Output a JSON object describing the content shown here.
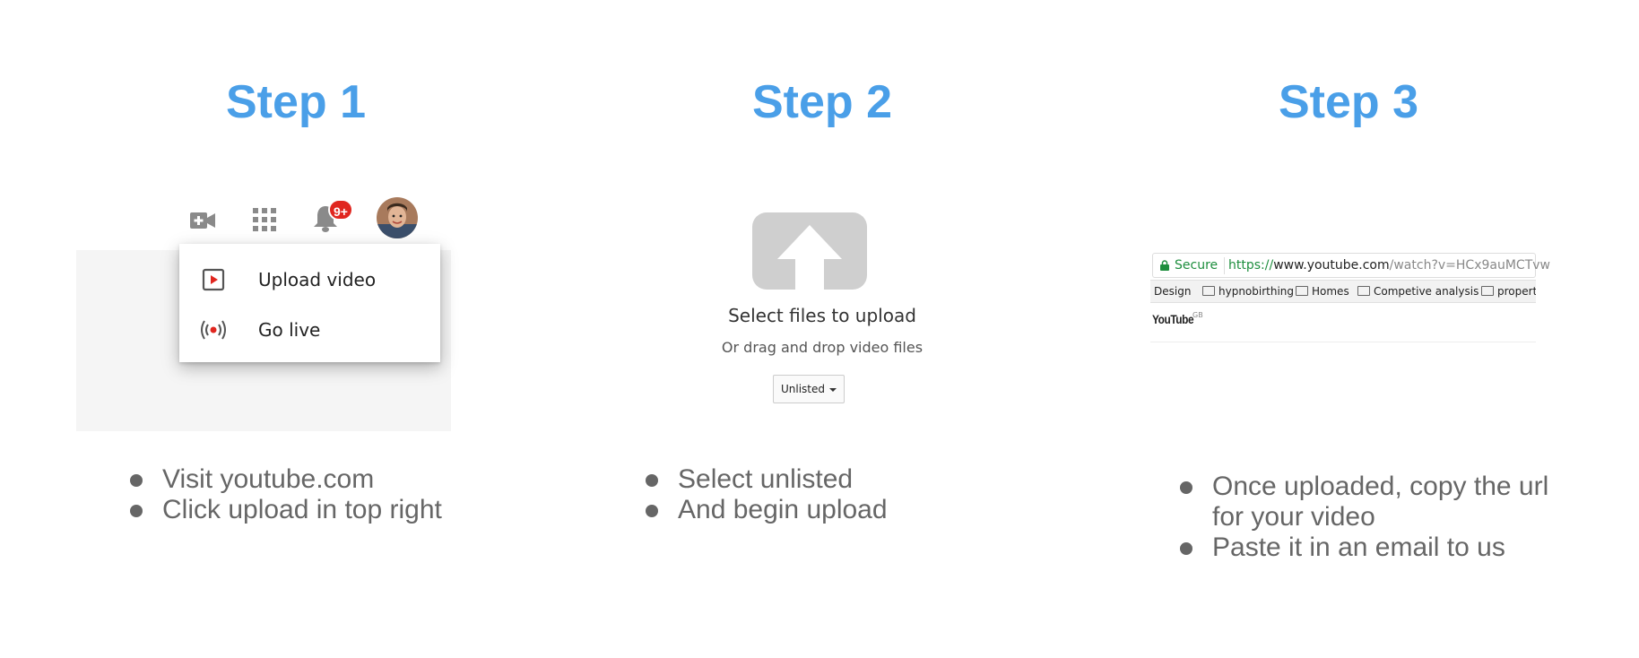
{
  "steps": [
    {
      "title": "Step 1",
      "bullets": [
        "Visit youtube.com",
        "Click upload in top right"
      ],
      "toolbar": {
        "icons": [
          "video-camera-add-icon",
          "apps-grid-icon",
          "notifications-bell-icon",
          "avatar"
        ],
        "notification_badge": "9+"
      },
      "menu": {
        "items": [
          {
            "label": "Upload video",
            "icon": "upload-video-icon"
          },
          {
            "label": "Go live",
            "icon": "go-live-icon"
          }
        ]
      }
    },
    {
      "title": "Step 2",
      "bullets": [
        "Select unlisted",
        "And begin upload"
      ],
      "upload": {
        "title": "Select files to upload",
        "subtitle": "Or drag and drop video files",
        "privacy_select": "Unlisted"
      }
    },
    {
      "title": "Step 3",
      "bullets": [
        "Once uploaded, copy the url for your video",
        "Paste it in an email to us"
      ],
      "browser": {
        "secure_label": "Secure",
        "url_scheme": "https://",
        "url_host": "www.youtube.com",
        "url_path": "/watch?v=HCx9auMCTvw",
        "bookmarks": [
          "Design",
          "hypnobirthing",
          "Homes",
          "Competive analysis",
          "propert"
        ],
        "logo": "YouTube",
        "logo_region": "GB"
      }
    }
  ],
  "colors": {
    "title": "#4a9fe8",
    "bullet_text": "#666666",
    "badge": "#e0261f",
    "secure_green": "#1e8e3e"
  }
}
